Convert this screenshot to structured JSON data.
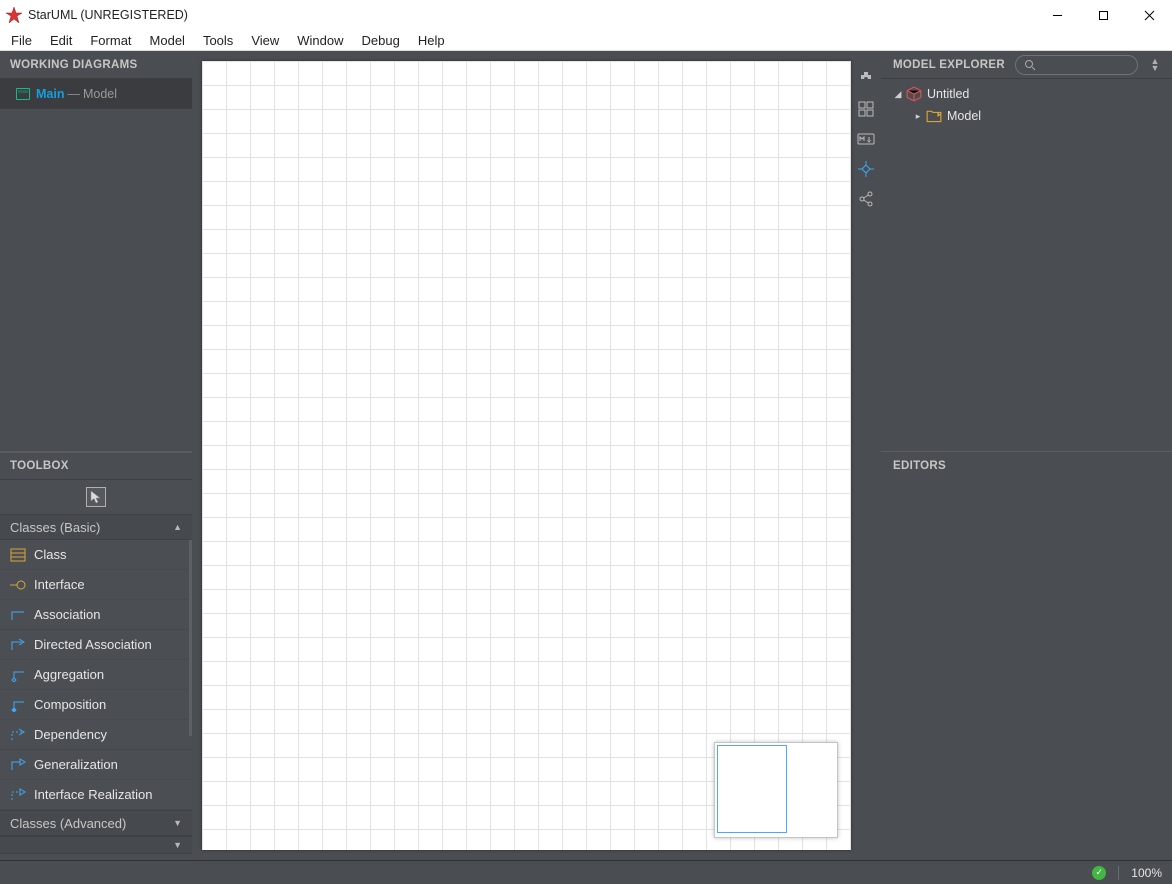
{
  "title": "StarUML (UNREGISTERED)",
  "menu": [
    "File",
    "Edit",
    "Format",
    "Model",
    "Tools",
    "View",
    "Window",
    "Debug",
    "Help"
  ],
  "panels": {
    "working_diagrams": "WORKING DIAGRAMS",
    "toolbox": "TOOLBOX",
    "model_explorer": "MODEL EXPLORER",
    "editors": "EDITORS"
  },
  "diagram": {
    "name": "Main",
    "sep": "—",
    "model": "Model"
  },
  "toolbox": {
    "section_basic": "Classes (Basic)",
    "section_advanced": "Classes (Advanced)",
    "items": [
      "Class",
      "Interface",
      "Association",
      "Directed Association",
      "Aggregation",
      "Composition",
      "Dependency",
      "Generalization",
      "Interface Realization"
    ]
  },
  "explorer": {
    "root": "Untitled",
    "child": "Model"
  },
  "status": {
    "zoom": "100%"
  },
  "icons": {
    "rail": [
      "extension-icon",
      "layout-grid-icon",
      "markdown-icon",
      "crosshair-icon",
      "share-icon"
    ]
  }
}
